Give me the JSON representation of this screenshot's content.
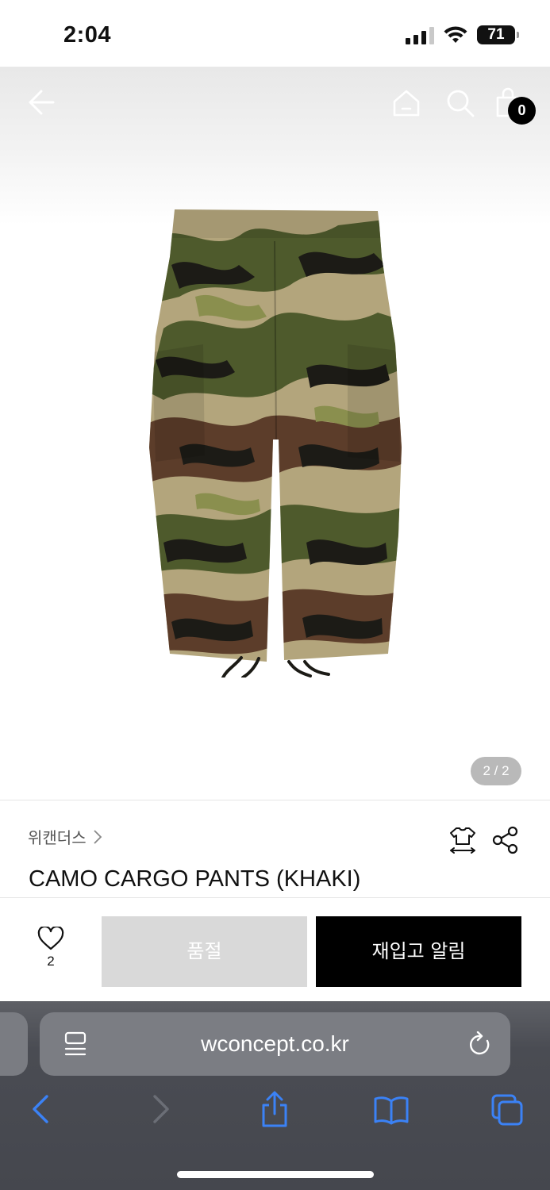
{
  "status_bar": {
    "time": "2:04",
    "battery": "71"
  },
  "header": {
    "cart_count": "0"
  },
  "gallery": {
    "page_indicator": "2 / 2"
  },
  "product": {
    "brand": "위캔더스",
    "title": "CAMO CARGO PANTS (KHAKI)"
  },
  "actions": {
    "like_count": "2",
    "soldout_label": "품절",
    "restock_label": "재입고 알림"
  },
  "browser": {
    "url": "wconcept.co.kr"
  },
  "colors": {
    "accent_black": "#000000",
    "soldout_gray": "#d9d9d9",
    "browser_link_blue": "#3b82f6",
    "camo_light": "#b3a57c",
    "camo_olive": "#4e5a2c",
    "camo_brown": "#5c3d2a",
    "camo_black": "#1c1b16"
  },
  "icons": [
    "back-arrow-icon",
    "home-icon",
    "search-icon",
    "shopping-bag-icon",
    "chevron-right-icon",
    "size-fit-icon",
    "share-icon",
    "heart-icon",
    "reader-icon",
    "reload-icon",
    "browser-back-icon",
    "browser-forward-icon",
    "share-up-icon",
    "bookmarks-icon",
    "tabs-icon"
  ]
}
